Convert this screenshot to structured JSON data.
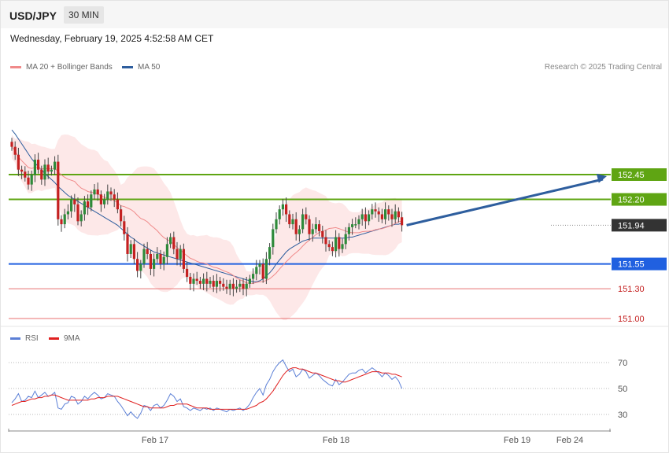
{
  "header": {
    "symbol": "USD/JPY",
    "timeframe": "30 MIN"
  },
  "datetime": "Wednesday, February 19, 2025 4:52:58 AM CET",
  "legend_top": [
    {
      "label": "MA 20 + Bollinger Bands",
      "color": "#f08a8a"
    },
    {
      "label": "MA 50",
      "color": "#2e5e9e"
    }
  ],
  "credit": "Research © 2025 Trading Central",
  "legend_bottom": [
    {
      "label": "RSI",
      "color": "#5b7fd6"
    },
    {
      "label": "9MA",
      "color": "#e02020"
    }
  ],
  "colors": {
    "bull": "#2e8a3a",
    "bear": "#c42020",
    "target": "#5fa513",
    "pivot": "#2060e0",
    "support": "#e87070",
    "last": "#333333",
    "arrow": "#2e5e9e",
    "band": "#fde4e4"
  },
  "chart_data": [
    {
      "type": "candlestick",
      "title": "USD/JPY",
      "ylim": [
        150.85,
        153.3
      ],
      "x_labels": [
        "Feb 17",
        "Feb 18",
        "Feb 19",
        "Feb 24"
      ],
      "levels": [
        {
          "value": "152.45",
          "kind": "target"
        },
        {
          "value": "152.20",
          "kind": "target"
        },
        {
          "value": "151.94",
          "kind": "last"
        },
        {
          "value": "151.55",
          "kind": "pivot"
        },
        {
          "value": "151.30",
          "kind": "support"
        },
        {
          "value": "151.00",
          "kind": "support"
        }
      ],
      "close": [
        152.73,
        152.65,
        152.5,
        152.48,
        152.42,
        152.35,
        152.45,
        152.6,
        152.5,
        152.4,
        152.55,
        152.48,
        152.5,
        152.58,
        152.0,
        151.95,
        152.05,
        152.08,
        152.2,
        152.15,
        151.98,
        152.05,
        152.18,
        152.12,
        152.25,
        152.3,
        152.25,
        152.15,
        152.2,
        152.28,
        152.25,
        152.2,
        152.1,
        151.98,
        151.85,
        151.65,
        151.75,
        151.6,
        151.48,
        151.55,
        151.7,
        151.65,
        151.5,
        151.6,
        151.65,
        151.55,
        151.62,
        151.75,
        151.82,
        151.7,
        151.6,
        151.7,
        151.5,
        151.42,
        151.35,
        151.4,
        151.38,
        151.35,
        151.4,
        151.35,
        151.38,
        151.32,
        151.38,
        151.35,
        151.32,
        151.3,
        151.35,
        151.3,
        151.32,
        151.35,
        151.3,
        151.35,
        151.4,
        151.45,
        151.52,
        151.55,
        151.4,
        151.6,
        151.72,
        151.9,
        152.0,
        152.1,
        152.15,
        152.05,
        151.95,
        152.0,
        151.85,
        151.9,
        152.05,
        152.0,
        151.85,
        151.9,
        151.95,
        151.88,
        151.82,
        151.75,
        151.72,
        151.68,
        151.82,
        151.7,
        151.75,
        151.85,
        151.92,
        151.95,
        151.95,
        152.0,
        152.05,
        151.98,
        152.05,
        152.1,
        152.08,
        152.05,
        152.0,
        152.1,
        152.05,
        152.0,
        152.08,
        152.02,
        151.94
      ],
      "open": [
        152.78,
        152.73,
        152.65,
        152.5,
        152.48,
        152.42,
        152.35,
        152.45,
        152.6,
        152.5,
        152.4,
        152.55,
        152.48,
        152.5,
        152.58,
        152.0,
        151.95,
        152.05,
        152.08,
        152.2,
        152.15,
        151.98,
        152.05,
        152.18,
        152.12,
        152.25,
        152.3,
        152.25,
        152.15,
        152.2,
        152.28,
        152.25,
        152.2,
        152.1,
        151.98,
        151.85,
        151.65,
        151.75,
        151.6,
        151.48,
        151.55,
        151.7,
        151.65,
        151.5,
        151.6,
        151.65,
        151.55,
        151.62,
        151.75,
        151.82,
        151.7,
        151.6,
        151.7,
        151.5,
        151.42,
        151.35,
        151.4,
        151.38,
        151.35,
        151.4,
        151.35,
        151.38,
        151.32,
        151.38,
        151.35,
        151.32,
        151.3,
        151.35,
        151.3,
        151.32,
        151.35,
        151.3,
        151.35,
        151.4,
        151.45,
        151.52,
        151.55,
        151.4,
        151.6,
        151.72,
        151.9,
        152.0,
        152.1,
        152.15,
        152.05,
        151.95,
        152.0,
        151.85,
        151.9,
        152.05,
        152.0,
        151.85,
        151.9,
        151.95,
        151.88,
        151.82,
        151.75,
        151.72,
        151.68,
        151.82,
        151.7,
        151.75,
        151.85,
        151.92,
        151.95,
        151.95,
        152.0,
        152.05,
        151.98,
        152.05,
        152.1,
        152.08,
        152.05,
        152.0,
        152.1,
        152.05,
        152.0,
        152.08,
        152.02
      ],
      "ma50": [
        152.9,
        152.86,
        152.81,
        152.76,
        152.71,
        152.66,
        152.61,
        152.57,
        152.53,
        152.5,
        152.46,
        152.43,
        152.4,
        152.37,
        152.33,
        152.3,
        152.27,
        152.24,
        152.22,
        152.2,
        152.18,
        152.16,
        152.14,
        152.12,
        152.1,
        152.08,
        152.06,
        152.04,
        152.02,
        152.0,
        151.98,
        151.96,
        151.94,
        151.91,
        151.88,
        151.85,
        151.82,
        151.8,
        151.77,
        151.75,
        151.73,
        151.71,
        151.69,
        151.67,
        151.66,
        151.65,
        151.64,
        151.63,
        151.62,
        151.61,
        151.6,
        151.59,
        151.58,
        151.57,
        151.56,
        151.55,
        151.54,
        151.53,
        151.52,
        151.51,
        151.5,
        151.49,
        151.48,
        151.47,
        151.46,
        151.45,
        151.44,
        151.43,
        151.42,
        151.41,
        151.4,
        151.39,
        151.38,
        151.37,
        151.37,
        151.38,
        151.4,
        151.43,
        151.46,
        151.5,
        151.55,
        151.59,
        151.63,
        151.67,
        151.7,
        151.72,
        151.74,
        151.76,
        151.78,
        151.79,
        151.8,
        151.81,
        151.81,
        151.81,
        151.81,
        151.81,
        151.81,
        151.81,
        151.81,
        151.81,
        151.81,
        151.81,
        151.82,
        151.82,
        151.83,
        151.84,
        151.85,
        151.86,
        151.87,
        151.88,
        151.89,
        151.9,
        151.91,
        151.92,
        151.93,
        151.94,
        151.95,
        151.95,
        151.96
      ],
      "rsi": [
        39,
        42,
        46,
        40,
        41,
        44,
        43,
        48,
        43,
        45,
        47,
        44,
        45,
        47,
        35,
        34,
        38,
        39,
        44,
        43,
        38,
        40,
        44,
        42,
        45,
        47,
        45,
        42,
        43,
        46,
        45,
        44,
        40,
        37,
        33,
        29,
        32,
        29,
        27,
        31,
        37,
        36,
        33,
        37,
        38,
        35,
        37,
        41,
        46,
        44,
        40,
        42,
        36,
        35,
        33,
        35,
        34,
        33,
        35,
        34,
        35,
        33,
        35,
        34,
        33,
        32,
        34,
        33,
        34,
        35,
        33,
        35,
        38,
        43,
        47,
        50,
        45,
        53,
        57,
        63,
        67,
        70,
        72,
        67,
        63,
        65,
        59,
        61,
        65,
        63,
        58,
        60,
        62,
        60,
        57,
        55,
        53,
        52,
        57,
        53,
        55,
        58,
        61,
        62,
        62,
        64,
        65,
        62,
        64,
        66,
        64,
        62,
        59,
        62,
        60,
        57,
        59,
        56,
        50
      ],
      "rsi_ma": [
        37,
        38,
        39,
        40,
        40,
        41,
        42,
        42,
        43,
        43,
        44,
        44,
        45,
        45,
        44,
        43,
        42,
        41,
        41,
        41,
        41,
        41,
        41,
        41,
        42,
        42,
        43,
        43,
        43,
        44,
        44,
        44,
        44,
        43,
        42,
        41,
        40,
        39,
        38,
        37,
        36,
        36,
        35,
        35,
        35,
        35,
        35,
        36,
        37,
        37,
        38,
        38,
        38,
        38,
        37,
        36,
        35,
        35,
        35,
        35,
        34,
        34,
        34,
        34,
        34,
        34,
        34,
        34,
        34,
        34,
        34,
        34,
        35,
        36,
        37,
        39,
        40,
        42,
        45,
        48,
        52,
        56,
        60,
        63,
        65,
        66,
        66,
        65,
        65,
        64,
        63,
        62,
        62,
        61,
        60,
        59,
        58,
        57,
        56,
        56,
        55,
        55,
        56,
        57,
        58,
        59,
        60,
        61,
        62,
        63,
        63,
        63,
        62,
        62,
        62,
        61,
        61,
        60,
        59
      ],
      "rsi_levels": [
        {
          "label": "70",
          "value": 70
        },
        {
          "label": "50",
          "value": 50
        },
        {
          "label": "30",
          "value": 30
        }
      ]
    }
  ]
}
